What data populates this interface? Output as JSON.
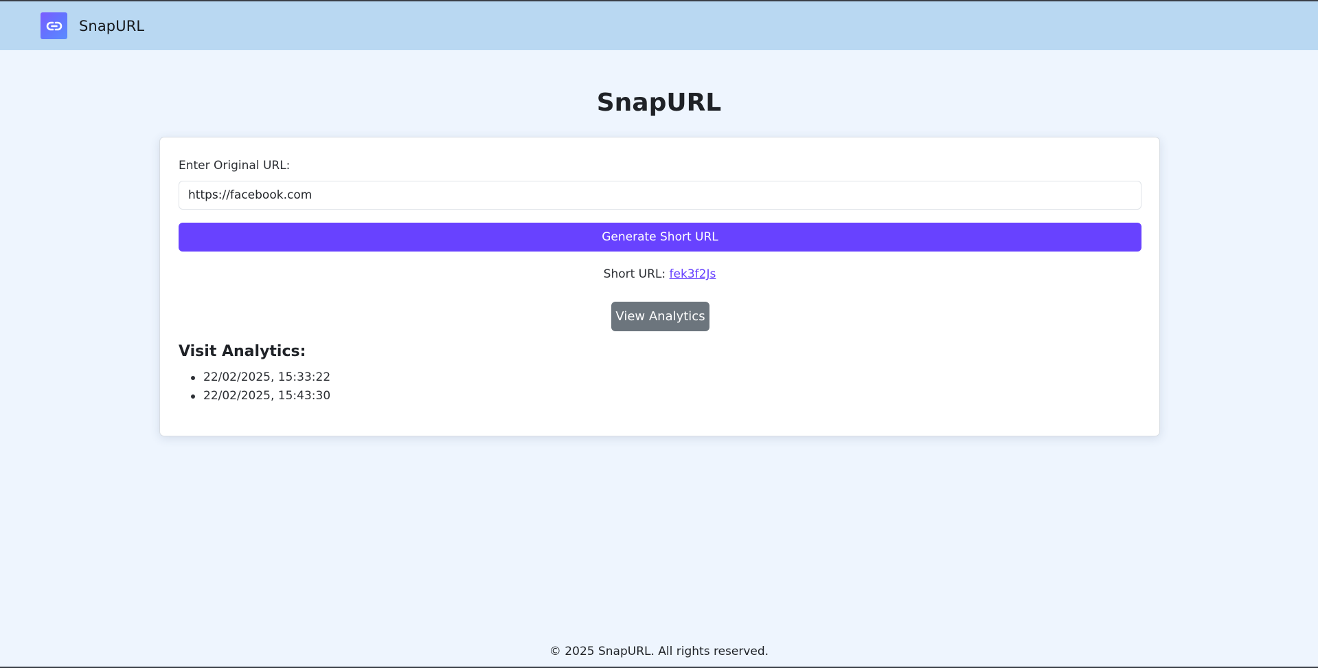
{
  "navbar": {
    "brand": "SnapURL",
    "logo_icon": "link-icon",
    "logo_color": "#6b60ff"
  },
  "main": {
    "title": "SnapURL",
    "form": {
      "label": "Enter Original URL:",
      "input_value": "https://facebook.com",
      "generate_button": "Generate Short URL"
    },
    "result": {
      "prefix": "Short URL:",
      "short_code": "fek3f2Js"
    },
    "analytics_button": "View Analytics",
    "analytics": {
      "heading": "Visit Analytics:",
      "visits": [
        "22/02/2025, 15:33:22",
        "22/02/2025, 15:43:30"
      ]
    }
  },
  "footer": {
    "text": "© 2025 SnapURL. All rights reserved."
  },
  "colors": {
    "navbar_bg": "#b9d8f2",
    "page_bg": "#eef5fe",
    "primary": "#6842ff",
    "secondary": "#6c757d"
  }
}
